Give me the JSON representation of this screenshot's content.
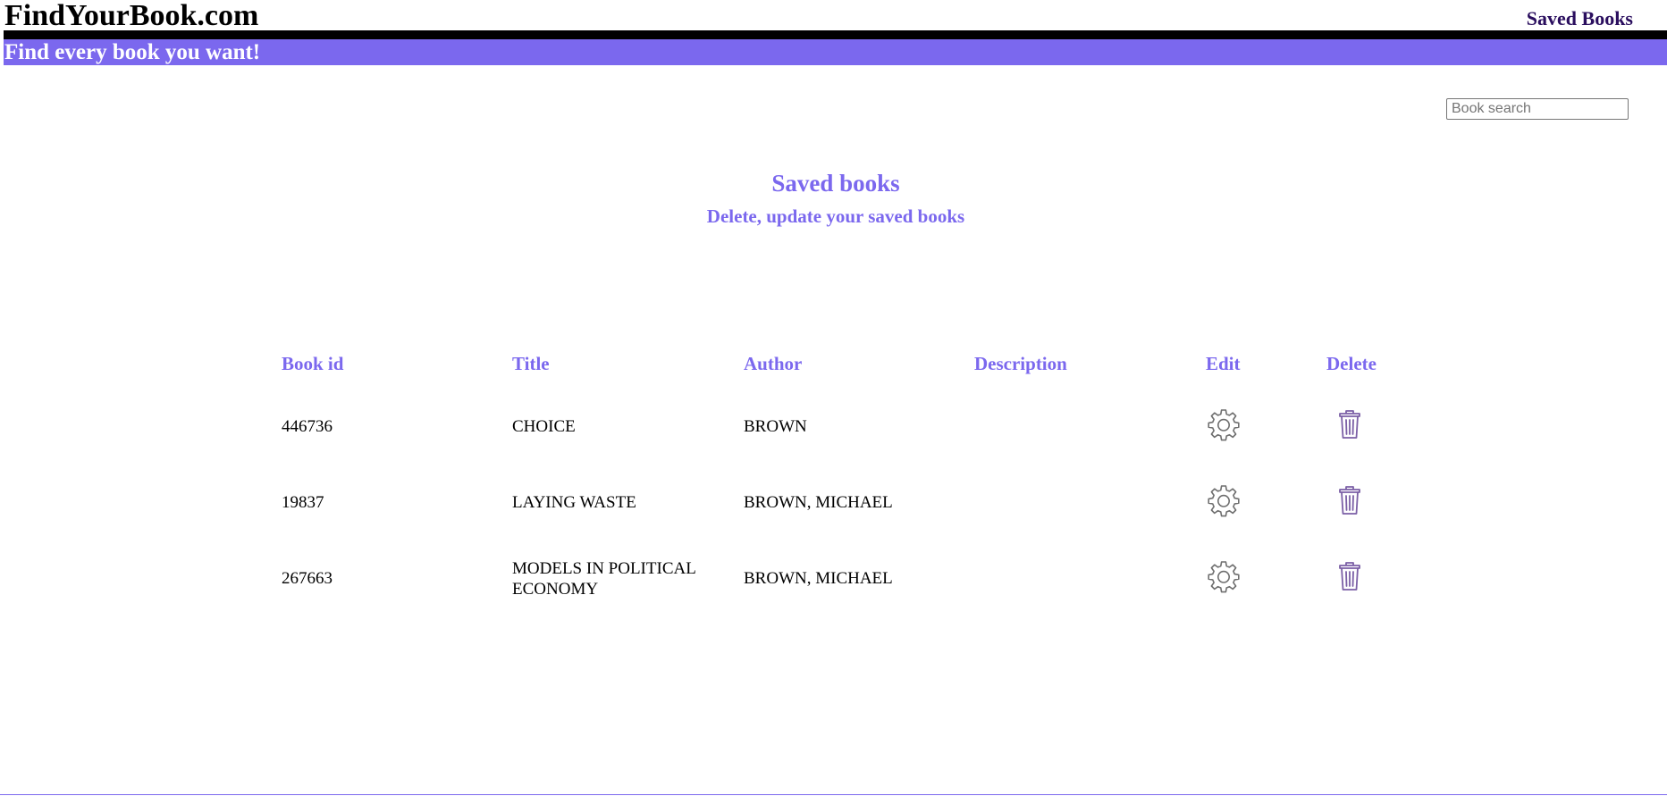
{
  "header": {
    "brand": "FindYourBook.com",
    "nav_saved": "Saved Books",
    "tagline": "Find every book you want!"
  },
  "search": {
    "placeholder": "Book search",
    "value": ""
  },
  "page": {
    "title": "Saved books",
    "subtitle": "Delete, update your saved books"
  },
  "table": {
    "headers": {
      "book_id": "Book id",
      "title": "Title",
      "author": "Author",
      "description": "Description",
      "edit": "Edit",
      "delete": "Delete"
    },
    "rows": [
      {
        "book_id": "446736",
        "title": "CHOICE",
        "author": "BROWN",
        "description": "",
        "edit_icon": "gear-icon",
        "delete_icon": "trash-icon"
      },
      {
        "book_id": "19837",
        "title": "LAYING WASTE",
        "author": "BROWN, MICHAEL",
        "description": "",
        "edit_icon": "gear-icon",
        "delete_icon": "trash-icon"
      },
      {
        "book_id": "267663",
        "title": "MODELS IN POLITICAL ECONOMY",
        "author": "BROWN, MICHAEL",
        "description": "",
        "edit_icon": "gear-icon",
        "delete_icon": "trash-icon"
      }
    ]
  },
  "colors": {
    "accent": "#7b68ee",
    "nav_link": "#2a0e5e",
    "gear": "#6e6e6e",
    "trash": "#7b5fa6"
  }
}
